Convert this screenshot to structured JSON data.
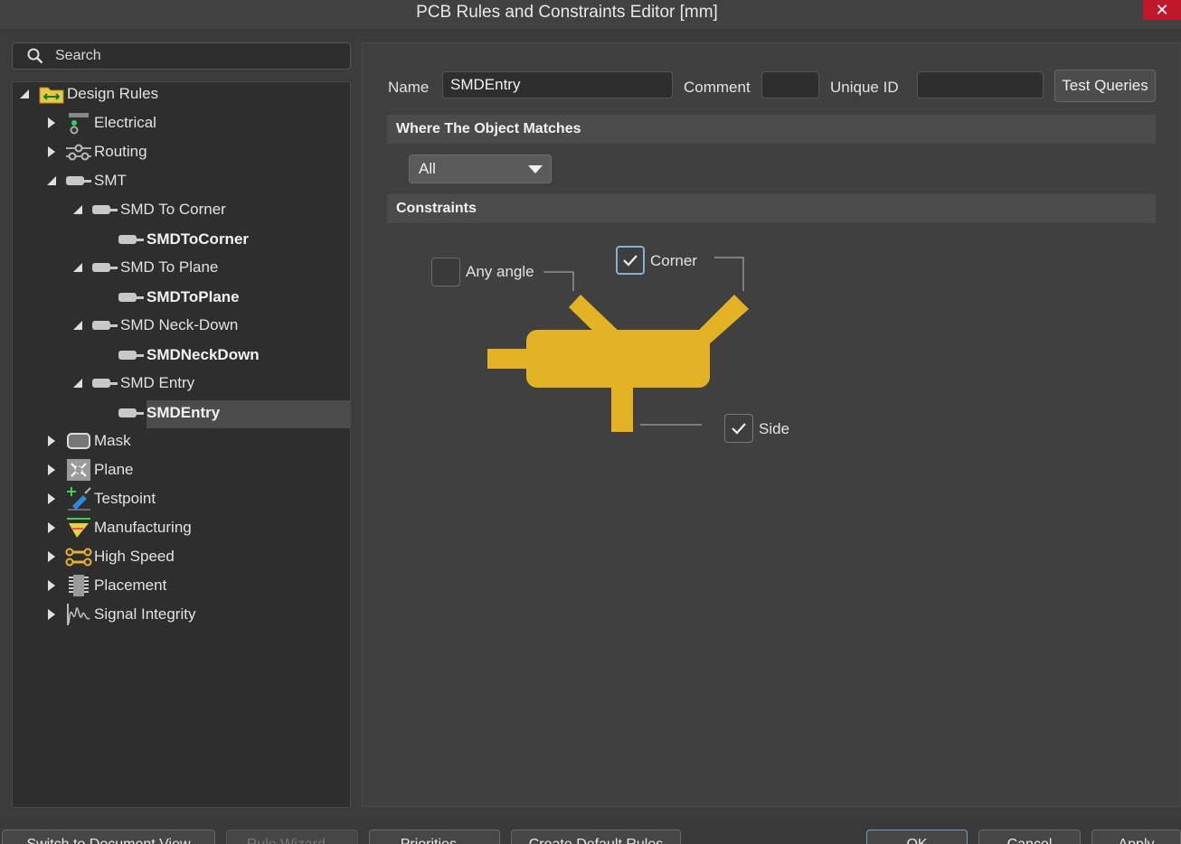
{
  "window": {
    "title": "PCB Rules and Constraints Editor [mm]",
    "close_glyph": "✕"
  },
  "search": {
    "placeholder": "Search"
  },
  "tree": {
    "root": "Design Rules",
    "electrical": "Electrical",
    "routing": "Routing",
    "smt": "SMT",
    "smd_to_corner": "SMD To Corner",
    "smd_to_corner_rule": "SMDToCorner",
    "smd_to_plane": "SMD To Plane",
    "smd_to_plane_rule": "SMDToPlane",
    "smd_neck_down": "SMD Neck-Down",
    "smd_neck_down_rule": "SMDNeckDown",
    "smd_entry": "SMD Entry",
    "smd_entry_rule": "SMDEntry",
    "mask": "Mask",
    "plane": "Plane",
    "testpoint": "Testpoint",
    "manufacturing": "Manufacturing",
    "high_speed": "High Speed",
    "placement": "Placement",
    "signal_integrity": "Signal Integrity"
  },
  "form": {
    "name_label": "Name",
    "name_value": "SMDEntry",
    "comment_label": "Comment",
    "comment_value": "",
    "unique_id_label": "Unique ID",
    "unique_id_value": "",
    "test_queries": "Test Queries"
  },
  "where": {
    "header": "Where The Object Matches",
    "selected": "All"
  },
  "constraints": {
    "header": "Constraints",
    "any_angle_label": "Any angle",
    "any_angle_checked": false,
    "corner_label": "Corner",
    "corner_checked": true,
    "side_label": "Side",
    "side_checked": true,
    "pad_color": "#e3b325"
  },
  "bottom": {
    "switch_view": "Switch to Document View",
    "rule_wizard": "Rule Wizard...",
    "priorities": "Priorities...",
    "create_default": "Create Default Rules",
    "ok": "OK",
    "cancel": "Cancel",
    "apply": "Apply"
  }
}
